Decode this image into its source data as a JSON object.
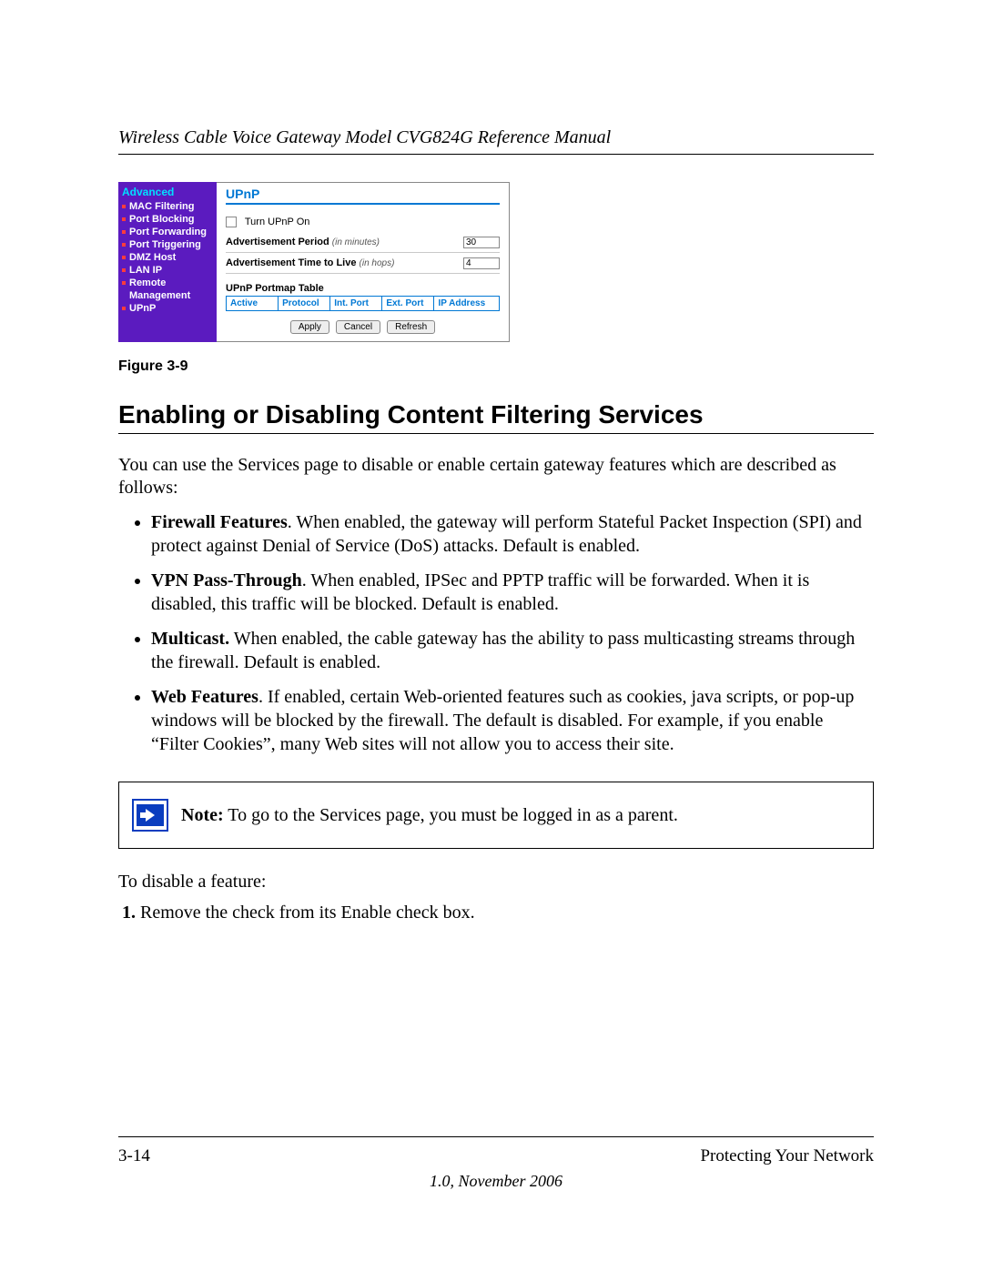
{
  "header": {
    "doc_title": "Wireless Cable Voice Gateway Model CVG824G Reference Manual"
  },
  "figure": {
    "sidebar_heading": "Advanced",
    "sidebar_items": [
      "MAC Filtering",
      "Port Blocking",
      "Port Forwarding",
      "Port Triggering",
      "DMZ Host",
      "LAN IP",
      "Remote Management",
      "UPnP"
    ],
    "pane_title": "UPnP",
    "turn_on_label": "Turn UPnP On",
    "ad_period_label": "Advertisement Period",
    "ad_period_unit": "(in minutes)",
    "ad_period_value": "30",
    "ad_ttl_label": "Advertisement Time to Live",
    "ad_ttl_unit": "(in hops)",
    "ad_ttl_value": "4",
    "portmap_label": "UPnP Portmap Table",
    "portmap_cols": [
      "Active",
      "Protocol",
      "Int. Port",
      "Ext. Port",
      "IP Address"
    ],
    "buttons": [
      "Apply",
      "Cancel",
      "Refresh"
    ]
  },
  "figure_caption": "Figure 3-9",
  "section_heading": "Enabling or Disabling Content Filtering Services",
  "intro_paragraph": "You can use the Services page to disable or enable certain gateway features which are described as follows:",
  "bullets": [
    {
      "term": "Firewall Features",
      "text": ". When enabled, the gateway will perform Stateful Packet Inspection (SPI) and protect against Denial of Service (DoS) attacks. Default is enabled."
    },
    {
      "term": "VPN Pass-Through",
      "text": ". When enabled, IPSec and PPTP traffic will be forwarded. When it is disabled, this traffic will be blocked. Default is enabled."
    },
    {
      "term": "Multicast.",
      "text": " When enabled, the cable gateway has the ability to pass multicasting streams through the firewall. Default is enabled."
    },
    {
      "term": "Web Features",
      "text": ". If enabled, certain Web-oriented features such as cookies, java scripts, or pop-up windows will be blocked by the firewall. The default is disabled. For example, if you enable “Filter Cookies”, many Web sites will not allow you to access their site."
    }
  ],
  "note": {
    "label": "Note:",
    "text": " To go to the Services page, you must be logged in as a parent."
  },
  "post_note_line": "To disable a feature:",
  "step1": "Remove the check from its Enable check box.",
  "footer": {
    "page_number": "3-14",
    "chapter": "Protecting Your Network",
    "version_date": "1.0, November 2006"
  }
}
